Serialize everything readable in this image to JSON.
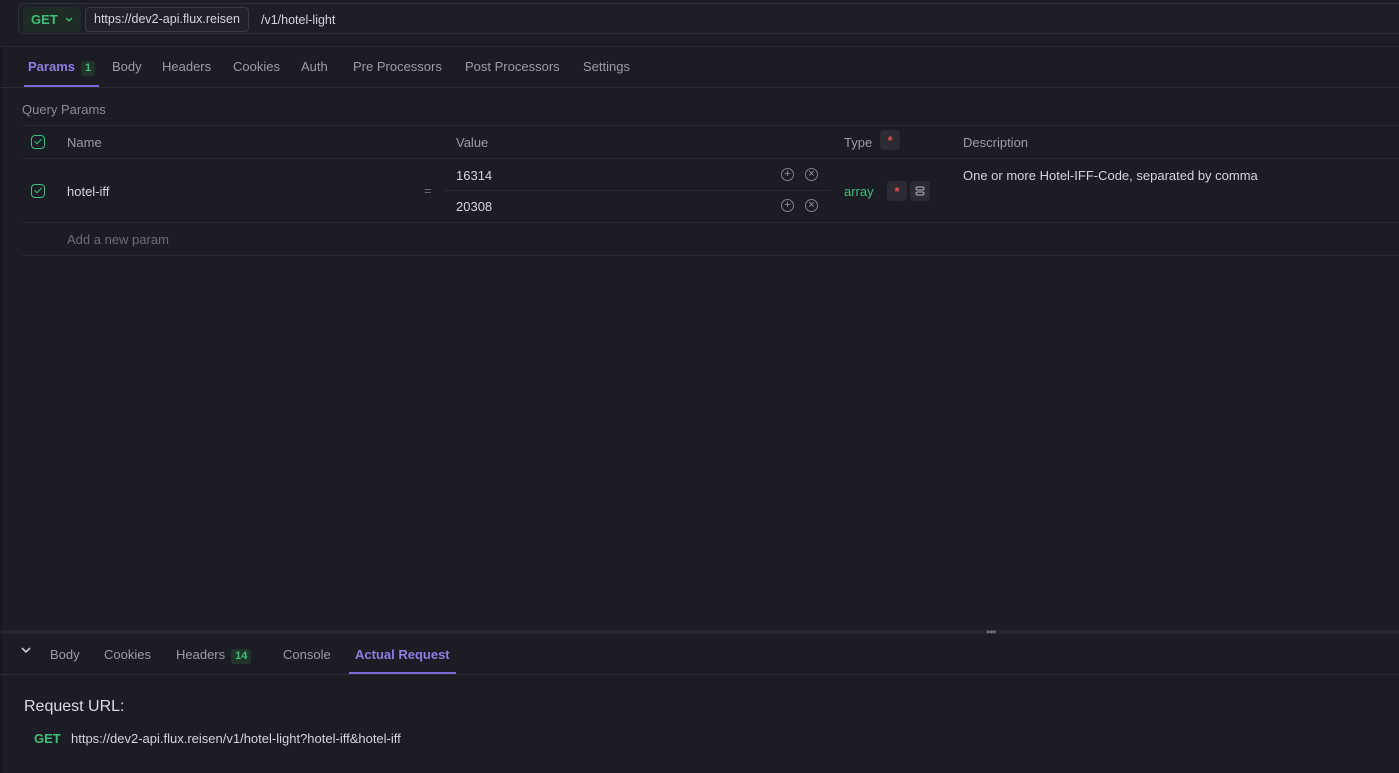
{
  "request": {
    "method": "GET",
    "base_url": "https://dev2-api.flux.reisen",
    "path": "/v1/hotel-light"
  },
  "request_tabs": [
    {
      "label": "Params",
      "badge": "1"
    },
    {
      "label": "Body"
    },
    {
      "label": "Headers"
    },
    {
      "label": "Cookies"
    },
    {
      "label": "Auth"
    },
    {
      "label": "Pre Processors"
    },
    {
      "label": "Post Processors"
    },
    {
      "label": "Settings"
    }
  ],
  "query_params": {
    "title": "Query Params",
    "columns": {
      "name": "Name",
      "value": "Value",
      "type": "Type",
      "type_marker": "*",
      "description": "Description"
    },
    "rows": [
      {
        "name": "hotel-iff",
        "separator": "=",
        "values": [
          "16314",
          "20308"
        ],
        "type": "array",
        "required_marker": "*",
        "description": "One or more Hotel-IFF-Code, separated by comma"
      }
    ],
    "add_placeholder": "Add a new param"
  },
  "response_tabs": [
    {
      "label": "Body"
    },
    {
      "label": "Cookies"
    },
    {
      "label": "Headers",
      "badge": "14"
    },
    {
      "label": "Console"
    },
    {
      "label": "Actual Request"
    }
  ],
  "actual_request": {
    "label": "Request URL:",
    "method": "GET",
    "url": "https://dev2-api.flux.reisen/v1/hotel-light?hotel-iff&hotel-iff"
  },
  "colors": {
    "accent": "#8f7de0",
    "success": "#3fbf79",
    "required": "#e05050",
    "background": "#1c1c24"
  },
  "icons": {
    "method_dropdown": "chevron-down-icon",
    "checkbox": "check-icon",
    "add_value": "plus-circle-icon",
    "remove_value": "x-circle-icon",
    "options": "settings-icon",
    "collapse": "chevron-down-icon"
  }
}
